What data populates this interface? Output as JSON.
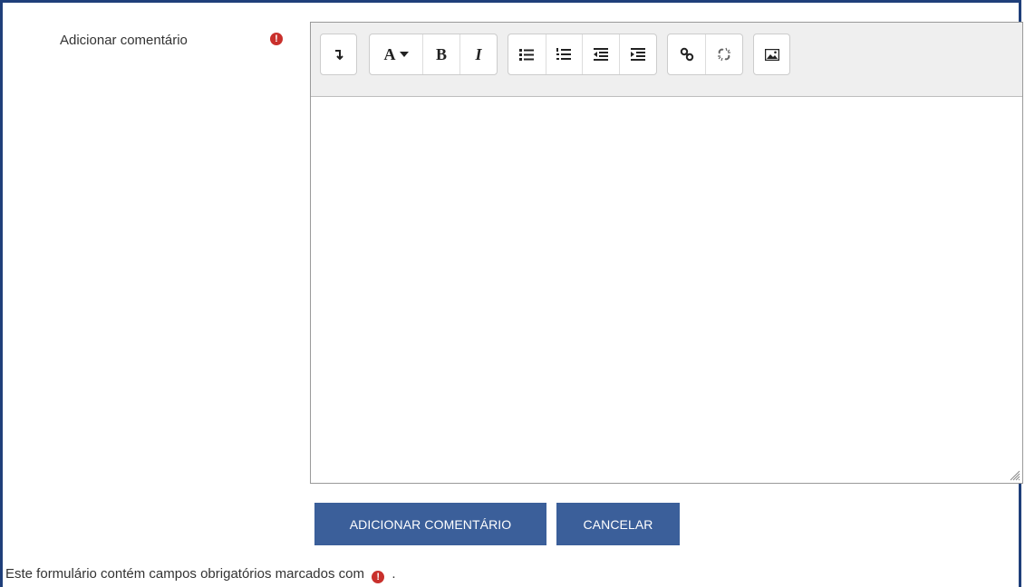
{
  "form": {
    "field_label": "Adicionar comentário",
    "required_icon": "exclamation-circle-icon"
  },
  "toolbar": {
    "groups": [
      {
        "items": [
          {
            "icon": "collapse-toolbar-icon",
            "glyph": "↴"
          }
        ]
      },
      {
        "items": [
          {
            "icon": "font-style-dropdown-icon",
            "glyph": "A▾"
          },
          {
            "icon": "bold-icon",
            "glyph": "B"
          },
          {
            "icon": "italic-icon",
            "glyph": "I"
          }
        ]
      },
      {
        "items": [
          {
            "icon": "unordered-list-icon"
          },
          {
            "icon": "ordered-list-icon"
          },
          {
            "icon": "outdent-icon"
          },
          {
            "icon": "indent-icon"
          }
        ]
      },
      {
        "items": [
          {
            "icon": "link-icon"
          },
          {
            "icon": "unlink-icon"
          }
        ]
      },
      {
        "items": [
          {
            "icon": "image-icon"
          }
        ]
      }
    ]
  },
  "buttons": {
    "submit_label": "ADICIONAR COMENTÁRIO",
    "cancel_label": "CANCELAR"
  },
  "footer": {
    "text_before": "Este formulário contém campos obrigatórios marcados com",
    "text_after": "."
  },
  "colors": {
    "button_bg": "#3b5f9a",
    "required": "#c9302c",
    "frame": "#1f3f7a"
  }
}
